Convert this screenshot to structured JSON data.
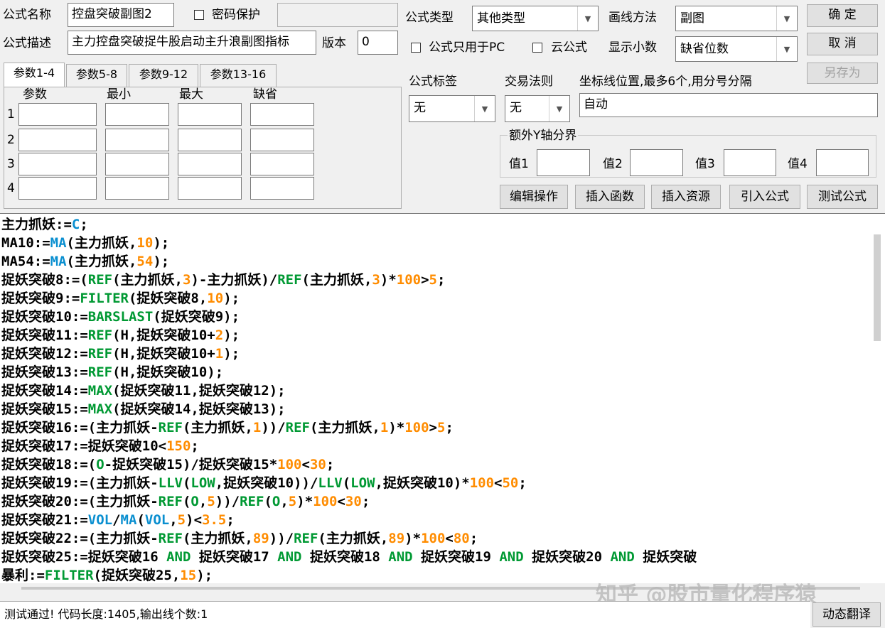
{
  "top": {
    "formula_name_label": "公式名称",
    "formula_name_value": "控盘突破副图2",
    "password_label": "密码保护",
    "formula_desc_label": "公式描述",
    "formula_desc_value": "主力控盘突破捉牛股启动主升浪副图指标",
    "version_label": "版本",
    "version_value": "0",
    "formula_type_label": "公式类型",
    "formula_type_value": "其他类型",
    "draw_method_label": "画线方法",
    "draw_method_value": "副图",
    "pc_only_label": "公式只用于PC",
    "cloud_label": "云公式",
    "decimals_label": "显示小数",
    "decimals_value": "缺省位数",
    "ok_button": "确 定",
    "cancel_button": "取 消",
    "saveas_button": "另存为"
  },
  "tabs": [
    "参数1-4",
    "参数5-8",
    "参数9-12",
    "参数13-16"
  ],
  "params": {
    "headers": [
      "参数",
      "最小",
      "最大",
      "缺省"
    ],
    "rows": [
      "1",
      "2",
      "3",
      "4"
    ]
  },
  "right": {
    "tag_label": "公式标签",
    "tag_value": "无",
    "trade_rule_label": "交易法则",
    "trade_rule_value": "无",
    "axis_label": "坐标线位置,最多6个,用分号分隔",
    "axis_value": "自动",
    "extra_y_label": "额外Y轴分界",
    "val_labels": [
      "值1",
      "值2",
      "值3",
      "值4"
    ]
  },
  "actions": [
    "编辑操作",
    "插入函数",
    "插入资源",
    "引入公式",
    "测试公式"
  ],
  "code": [
    [
      [
        "t",
        "主力抓妖:="
      ],
      [
        "f",
        "C"
      ],
      [
        "t",
        ";"
      ]
    ],
    [
      [
        "t",
        "MA10:="
      ],
      [
        "f",
        "MA"
      ],
      [
        "t",
        "(主力抓妖,"
      ],
      [
        "n",
        "10"
      ],
      [
        "t",
        ");"
      ]
    ],
    [
      [
        "t",
        "MA54:="
      ],
      [
        "f",
        "MA"
      ],
      [
        "t",
        "(主力抓妖,"
      ],
      [
        "n",
        "54"
      ],
      [
        "t",
        ");"
      ]
    ],
    [
      [
        "t",
        "捉妖突破8:=("
      ],
      [
        "kw",
        "REF"
      ],
      [
        "t",
        "(主力抓妖,"
      ],
      [
        "n",
        "3"
      ],
      [
        "t",
        ")-主力抓妖)/"
      ],
      [
        "kw",
        "REF"
      ],
      [
        "t",
        "(主力抓妖,"
      ],
      [
        "n",
        "3"
      ],
      [
        "t",
        ")*"
      ],
      [
        "n",
        "100"
      ],
      [
        "t",
        ">"
      ],
      [
        "n",
        "5"
      ],
      [
        "t",
        ";"
      ]
    ],
    [
      [
        "t",
        "捉妖突破9:="
      ],
      [
        "kw",
        "FILTER"
      ],
      [
        "t",
        "(捉妖突破8,"
      ],
      [
        "n",
        "10"
      ],
      [
        "t",
        ");"
      ]
    ],
    [
      [
        "t",
        "捉妖突破10:="
      ],
      [
        "kw",
        "BARSLAST"
      ],
      [
        "t",
        "(捉妖突破9);"
      ]
    ],
    [
      [
        "t",
        "捉妖突破11:="
      ],
      [
        "kw",
        "REF"
      ],
      [
        "t",
        "(H,捉妖突破10+"
      ],
      [
        "n",
        "2"
      ],
      [
        "t",
        ");"
      ]
    ],
    [
      [
        "t",
        "捉妖突破12:="
      ],
      [
        "kw",
        "REF"
      ],
      [
        "t",
        "(H,捉妖突破10+"
      ],
      [
        "n",
        "1"
      ],
      [
        "t",
        ");"
      ]
    ],
    [
      [
        "t",
        "捉妖突破13:="
      ],
      [
        "kw",
        "REF"
      ],
      [
        "t",
        "(H,捉妖突破10);"
      ]
    ],
    [
      [
        "t",
        "捉妖突破14:="
      ],
      [
        "kw",
        "MAX"
      ],
      [
        "t",
        "(捉妖突破11,捉妖突破12);"
      ]
    ],
    [
      [
        "t",
        "捉妖突破15:="
      ],
      [
        "kw",
        "MAX"
      ],
      [
        "t",
        "(捉妖突破14,捉妖突破13);"
      ]
    ],
    [
      [
        "t",
        "捉妖突破16:=(主力抓妖-"
      ],
      [
        "kw",
        "REF"
      ],
      [
        "t",
        "(主力抓妖,"
      ],
      [
        "n",
        "1"
      ],
      [
        "t",
        "))/"
      ],
      [
        "kw",
        "REF"
      ],
      [
        "t",
        "(主力抓妖,"
      ],
      [
        "n",
        "1"
      ],
      [
        "t",
        ")*"
      ],
      [
        "n",
        "100"
      ],
      [
        "t",
        ">"
      ],
      [
        "n",
        "5"
      ],
      [
        "t",
        ";"
      ]
    ],
    [
      [
        "t",
        "捉妖突破17:=捉妖突破10<"
      ],
      [
        "n",
        "150"
      ],
      [
        "t",
        ";"
      ]
    ],
    [
      [
        "t",
        "捉妖突破18:=("
      ],
      [
        "kw",
        "O"
      ],
      [
        "t",
        "-捉妖突破15)/捉妖突破15*"
      ],
      [
        "n",
        "100"
      ],
      [
        "t",
        "<"
      ],
      [
        "n",
        "30"
      ],
      [
        "t",
        ";"
      ]
    ],
    [
      [
        "t",
        "捉妖突破19:=(主力抓妖-"
      ],
      [
        "kw",
        "LLV"
      ],
      [
        "t",
        "("
      ],
      [
        "kw",
        "LOW"
      ],
      [
        "t",
        ",捉妖突破10))/"
      ],
      [
        "kw",
        "LLV"
      ],
      [
        "t",
        "("
      ],
      [
        "kw",
        "LOW"
      ],
      [
        "t",
        ",捉妖突破10)*"
      ],
      [
        "n",
        "100"
      ],
      [
        "t",
        "<"
      ],
      [
        "n",
        "50"
      ],
      [
        "t",
        ";"
      ]
    ],
    [
      [
        "t",
        "捉妖突破20:=(主力抓妖-"
      ],
      [
        "kw",
        "REF"
      ],
      [
        "t",
        "("
      ],
      [
        "kw",
        "O"
      ],
      [
        "t",
        ","
      ],
      [
        "n",
        "5"
      ],
      [
        "t",
        "))/"
      ],
      [
        "kw",
        "REF"
      ],
      [
        "t",
        "("
      ],
      [
        "kw",
        "O"
      ],
      [
        "t",
        ","
      ],
      [
        "n",
        "5"
      ],
      [
        "t",
        ")*"
      ],
      [
        "n",
        "100"
      ],
      [
        "t",
        "<"
      ],
      [
        "n",
        "30"
      ],
      [
        "t",
        ";"
      ]
    ],
    [
      [
        "t",
        "捉妖突破21:="
      ],
      [
        "f",
        "VOL"
      ],
      [
        "t",
        "/"
      ],
      [
        "f",
        "MA"
      ],
      [
        "t",
        "("
      ],
      [
        "f",
        "VOL"
      ],
      [
        "t",
        ","
      ],
      [
        "n",
        "5"
      ],
      [
        "t",
        ")<"
      ],
      [
        "n",
        "3.5"
      ],
      [
        "t",
        ";"
      ]
    ],
    [
      [
        "t",
        "捉妖突破22:=(主力抓妖-"
      ],
      [
        "kw",
        "REF"
      ],
      [
        "t",
        "(主力抓妖,"
      ],
      [
        "n",
        "89"
      ],
      [
        "t",
        "))/"
      ],
      [
        "kw",
        "REF"
      ],
      [
        "t",
        "(主力抓妖,"
      ],
      [
        "n",
        "89"
      ],
      [
        "t",
        ")*"
      ],
      [
        "n",
        "100"
      ],
      [
        "t",
        "<"
      ],
      [
        "n",
        "80"
      ],
      [
        "t",
        ";"
      ]
    ],
    [
      [
        "t",
        "捉妖突破25:=捉妖突破16 "
      ],
      [
        "kw",
        "AND"
      ],
      [
        "t",
        " 捉妖突破17 "
      ],
      [
        "kw",
        "AND"
      ],
      [
        "t",
        " 捉妖突破18 "
      ],
      [
        "kw",
        "AND"
      ],
      [
        "t",
        " 捉妖突破19 "
      ],
      [
        "kw",
        "AND"
      ],
      [
        "t",
        " 捉妖突破20 "
      ],
      [
        "kw",
        "AND"
      ],
      [
        "t",
        " 捉妖突破"
      ]
    ],
    [
      [
        "t",
        "暴利:="
      ],
      [
        "kw",
        "FILTER"
      ],
      [
        "t",
        "(捉妖突破25,"
      ],
      [
        "n",
        "15"
      ],
      [
        "t",
        ");"
      ]
    ]
  ],
  "status_text": "测试通过! 代码长度:1405,输出线个数:1",
  "translate_button": "动态翻译",
  "watermark": "知乎 @股市量化程序猿"
}
